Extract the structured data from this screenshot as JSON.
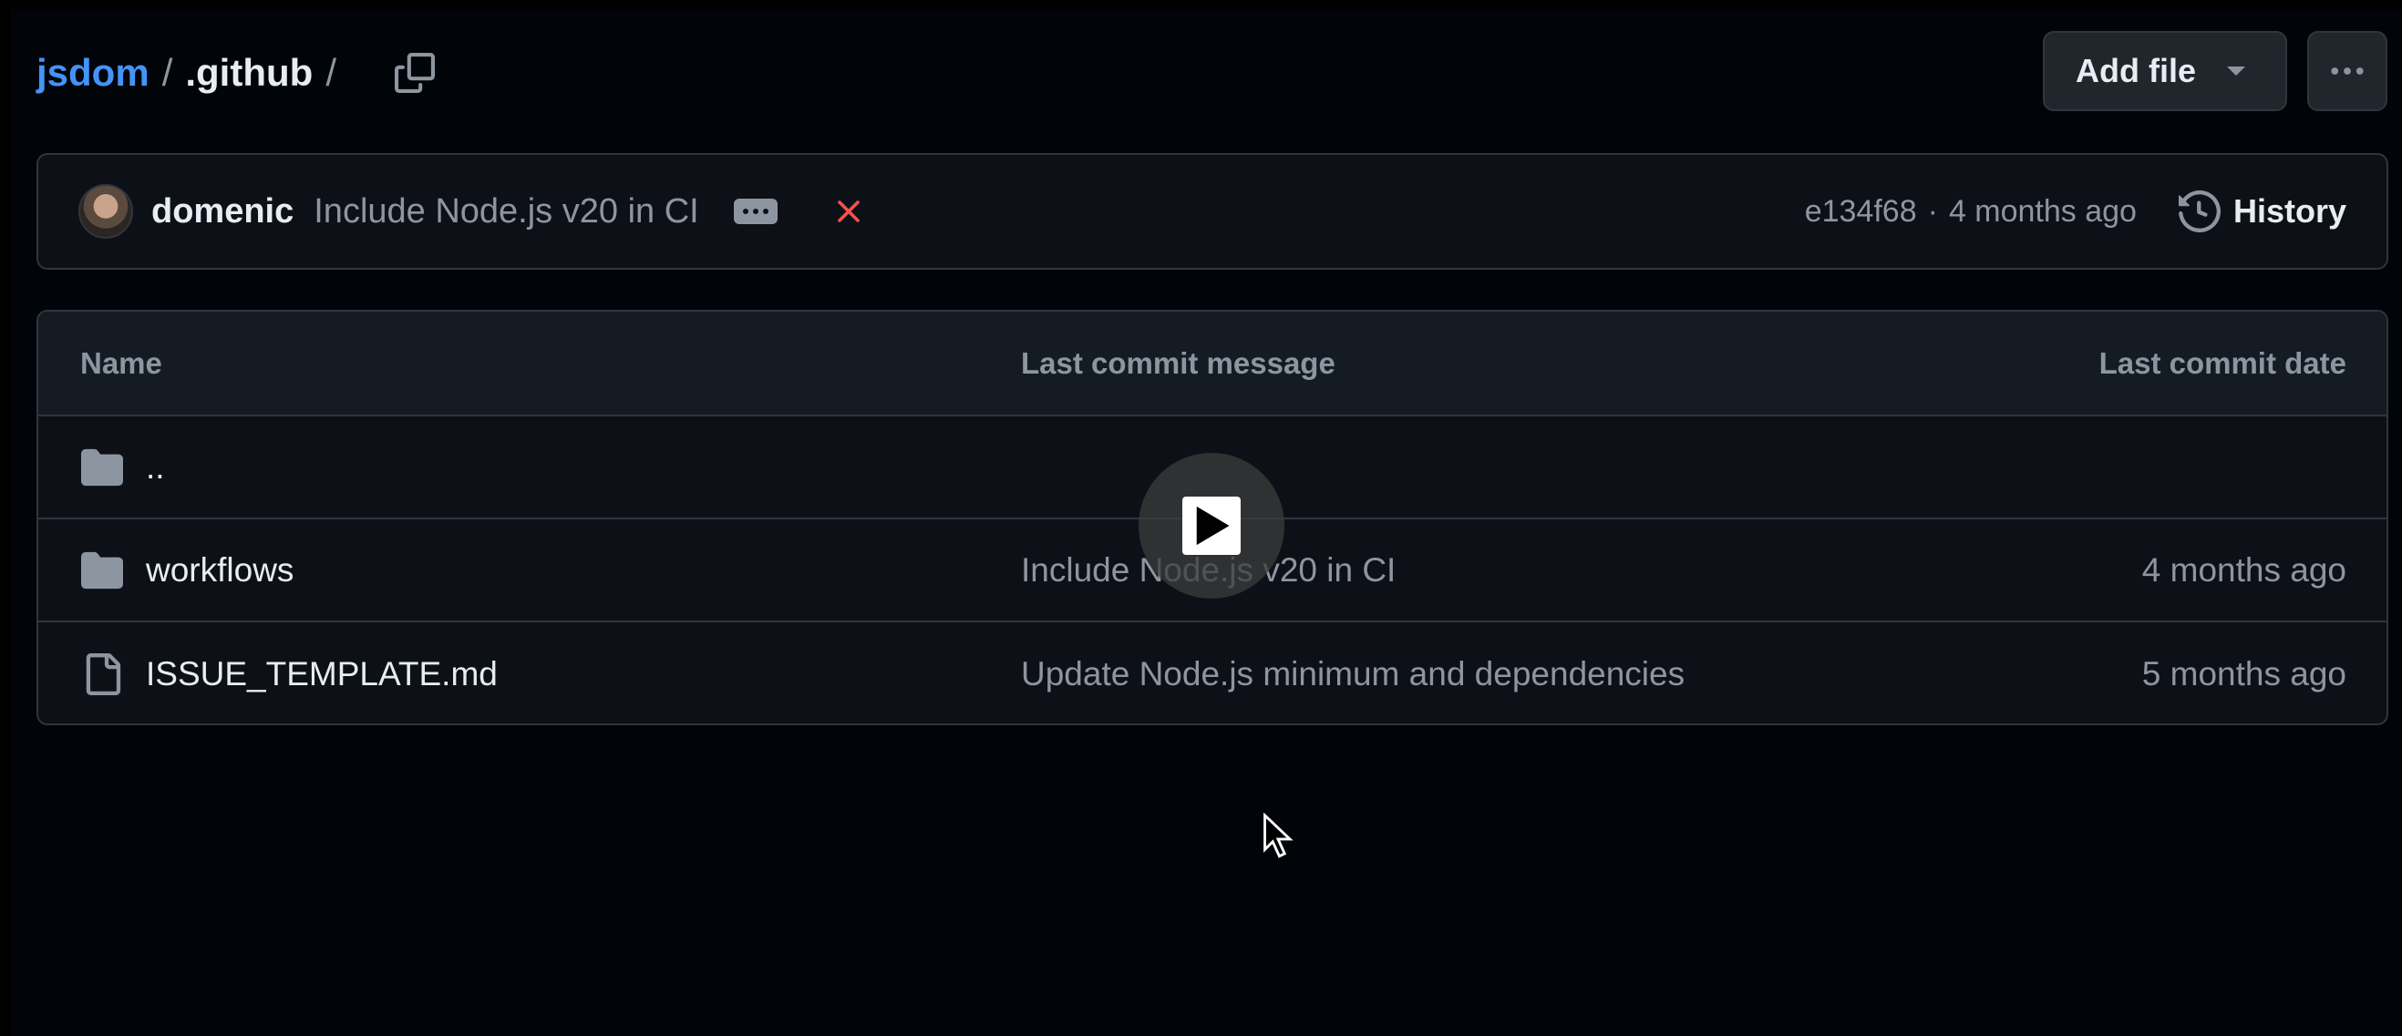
{
  "breadcrumb": {
    "repo": "jsdom",
    "sep1": "/",
    "folder": ".github",
    "sep2": "/"
  },
  "toolbar": {
    "add_file_label": "Add file"
  },
  "commit": {
    "author": "domenic",
    "message": "Include Node.js v20 in CI",
    "sha": "e134f68",
    "dot": "·",
    "time": "4 months ago",
    "history_label": "History"
  },
  "table": {
    "headers": {
      "name": "Name",
      "message": "Last commit message",
      "date": "Last commit date"
    },
    "rows": [
      {
        "type": "folder",
        "name": "..",
        "message": "",
        "date": ""
      },
      {
        "type": "folder",
        "name": "workflows",
        "message": "Include Node.js v20 in CI",
        "date": "4 months ago"
      },
      {
        "type": "file",
        "name": "ISSUE_TEMPLATE.md",
        "message": "Update Node.js minimum and dependencies",
        "date": "5 months ago"
      }
    ]
  },
  "icons": {
    "copy": "copy-icon",
    "kebab": "kebab-horizontal-icon",
    "fail": "x-icon",
    "history": "history-icon",
    "folder": "folder-icon",
    "file": "file-icon",
    "play": "play-icon"
  },
  "colors": {
    "link": "#4493f8",
    "fail": "#f85149",
    "muted": "#8d96a0"
  }
}
